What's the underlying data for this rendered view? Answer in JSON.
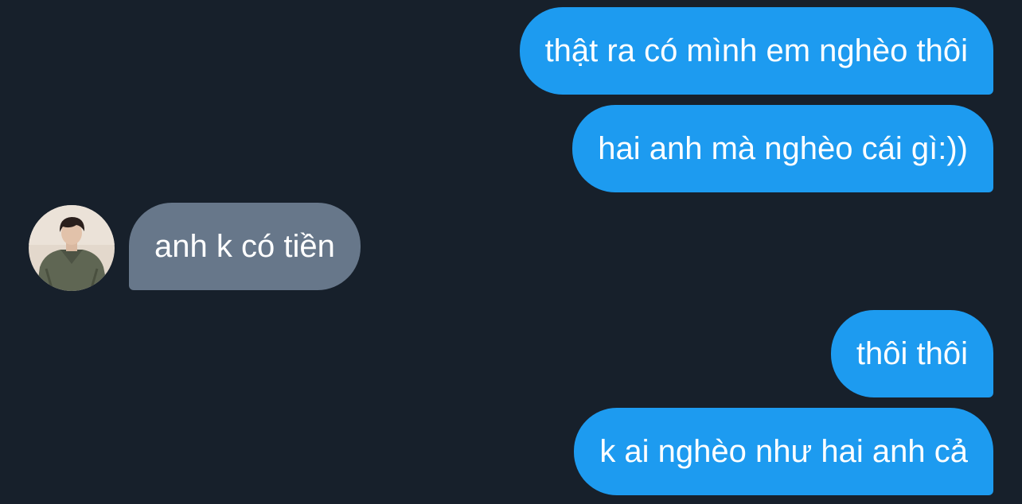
{
  "conversation": {
    "messages": [
      {
        "sender": "me",
        "text": "thật ra có mình em nghèo thôi"
      },
      {
        "sender": "me",
        "text": "hai anh mà nghèo cái gì:))"
      },
      {
        "sender": "other",
        "text": "anh k có tiền"
      },
      {
        "sender": "me",
        "text": "thôi thôi"
      },
      {
        "sender": "me",
        "text": "k ai nghèo như hai anh cả"
      }
    ]
  },
  "colors": {
    "background": "#17202b",
    "outgoing_bubble": "#1d9bf0",
    "incoming_bubble": "#67778a",
    "text": "#ffffff"
  }
}
